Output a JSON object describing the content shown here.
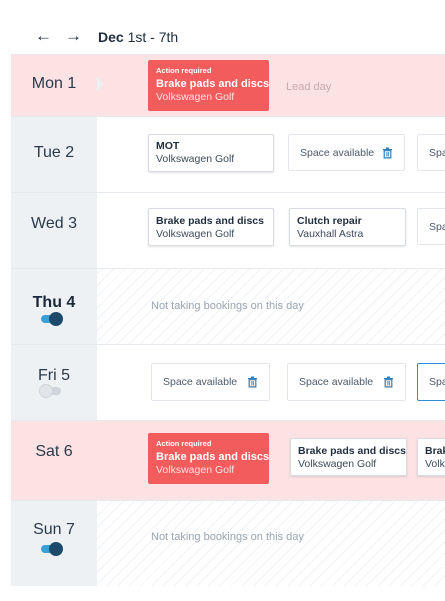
{
  "header": {
    "prev_icon": "arrow-left-icon",
    "next_icon": "arrow-right-icon",
    "prev_glyph": "←",
    "next_glyph": "→",
    "week_month": "Dec",
    "week_range": "1st - 7th"
  },
  "colors": {
    "alert_row_bg": "#fde2e3",
    "alert_card_bg": "#f25c5c",
    "toggle_on": "#1d4a6b",
    "selected_border": "#2d8cd8"
  },
  "days": {
    "mon": {
      "label": "Mon 1",
      "lead_day": "Lead day",
      "alert_card": {
        "tag": "Action required",
        "title": "Brake pads and discs",
        "sub": "Volkswagen Golf"
      }
    },
    "tue": {
      "label": "Tue 2",
      "booking": {
        "title": "MOT",
        "sub": "Volkswagen Golf"
      },
      "space_1": "Space available",
      "space_2": "Spa"
    },
    "wed": {
      "label": "Wed 3",
      "booking_1": {
        "title": "Brake pads and discs",
        "sub": "Volkswagen Golf"
      },
      "booking_2": {
        "title": "Clutch repair",
        "sub": "Vauxhall Astra"
      },
      "space_1": "Spa"
    },
    "thu": {
      "label": "Thu 4",
      "closed_text": "Not taking bookings on this day",
      "toggle": "on"
    },
    "fri": {
      "label": "Fri 5",
      "toggle": "off",
      "space_1": "Space available",
      "space_2": "Space available",
      "space_3": "Spa"
    },
    "sat": {
      "label": "Sat 6",
      "alert_card": {
        "tag": "Action required",
        "title": "Brake pads and discs",
        "sub": "Volkswagen Golf"
      },
      "booking_1": {
        "title": "Brake pads and discs",
        "sub": "Volkswagen Golf"
      },
      "booking_2": {
        "title": "Brak",
        "sub": "Volk"
      }
    },
    "sun": {
      "label": "Sun 7",
      "closed_text": "Not taking bookings on this day",
      "toggle": "on"
    }
  }
}
